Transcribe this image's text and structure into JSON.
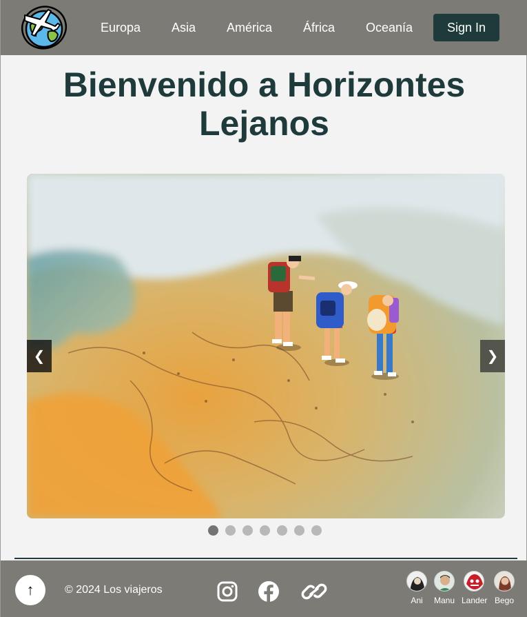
{
  "header": {
    "logo_icon": "globe-airplane-icon",
    "nav": [
      {
        "label": "Europa"
      },
      {
        "label": "Asia"
      },
      {
        "label": "América"
      },
      {
        "label": "África"
      },
      {
        "label": "Oceanía"
      }
    ],
    "sign_in_label": "Sign In",
    "background": "#7c7b75",
    "button_color": "#1f3a3b"
  },
  "main": {
    "title": "Bienvenido a Horizontes Lejanos",
    "carousel": {
      "prev_label": "❮",
      "next_label": "❯",
      "slide_count": 7,
      "active_index": 0,
      "image_icon": "travelers-on-map-photo"
    }
  },
  "footer": {
    "back_to_top_label": "↑",
    "copyright": "© 2024 Los viajeros",
    "social_icons": [
      "instagram-icon",
      "facebook-icon",
      "link-icon"
    ],
    "authors": [
      {
        "name": "Ani"
      },
      {
        "name": "Manu"
      },
      {
        "name": "Lander"
      },
      {
        "name": "Bego"
      }
    ]
  }
}
